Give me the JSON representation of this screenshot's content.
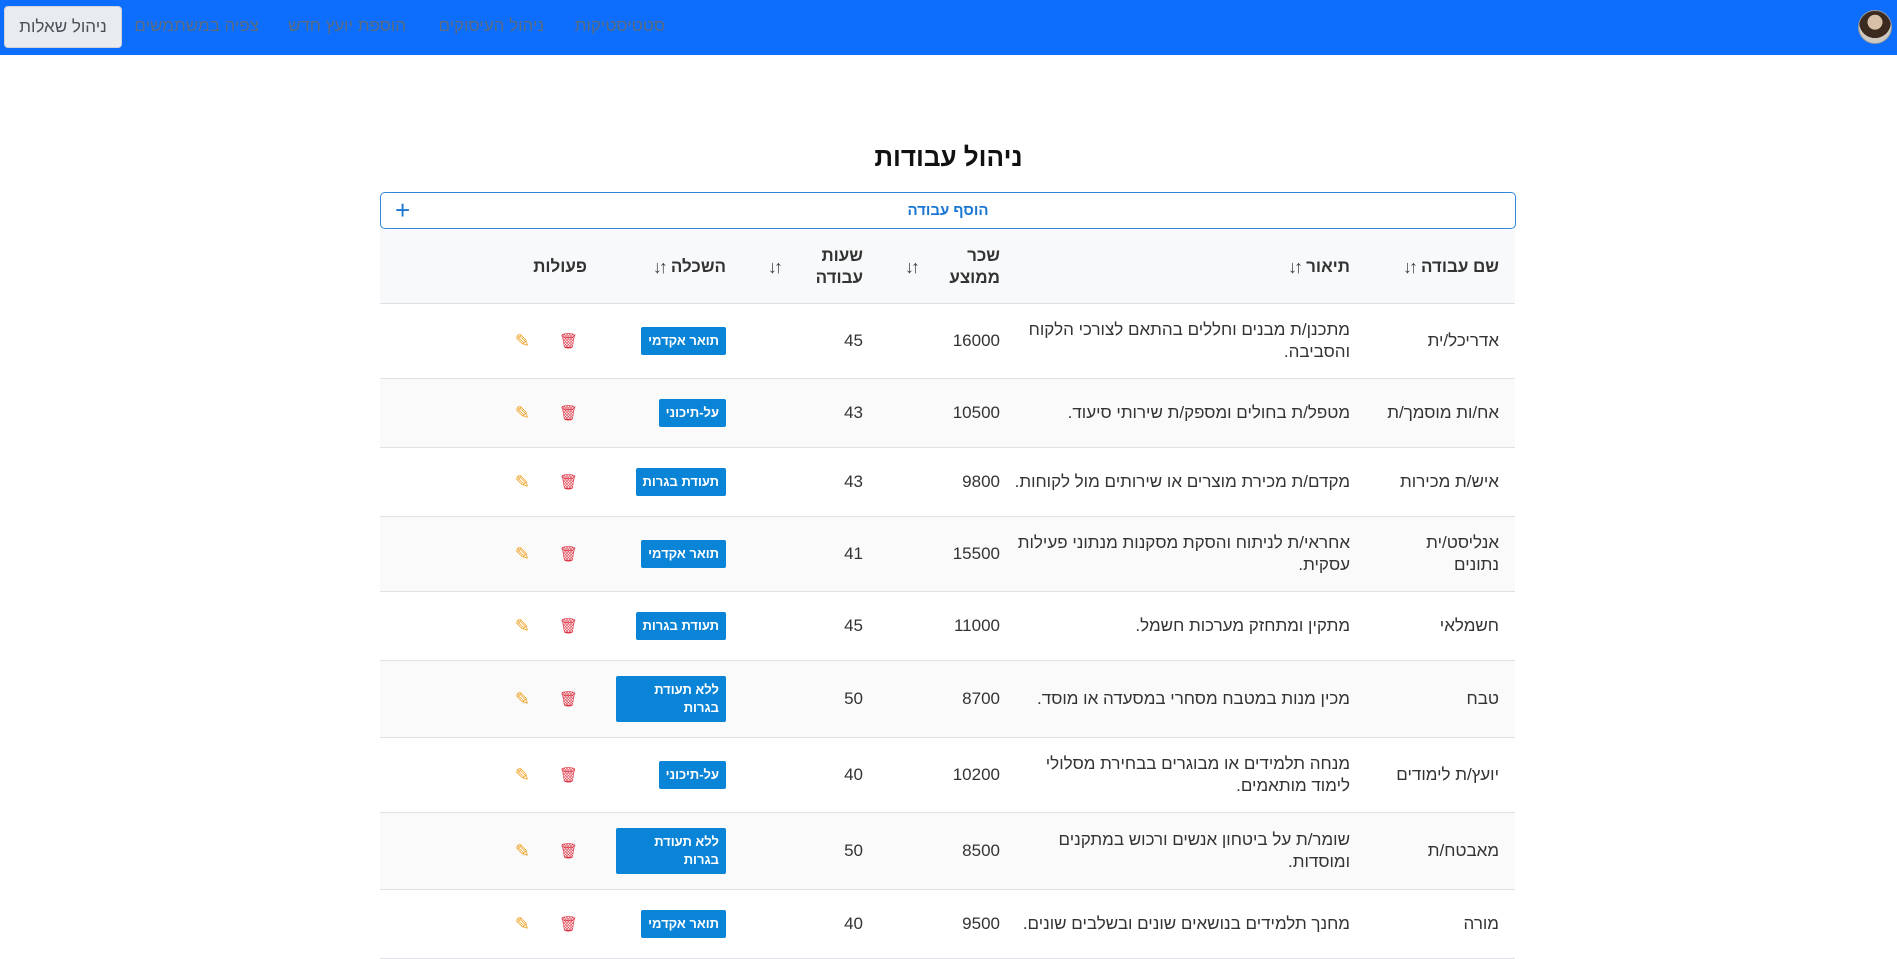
{
  "nav": {
    "active": "ניהול שאלות",
    "links": [
      "צפיה במשתמשים",
      "הוספת יועץ חדש",
      "ניהול העיסוקים",
      "סטטיסטיקות"
    ]
  },
  "page": {
    "title": "ניהול עבודות",
    "add_button": "הוסף עבודה"
  },
  "table": {
    "headers": {
      "name": "שם עבודה",
      "description": "תיאור",
      "salary": "שכר ממוצע",
      "hours": "שעות עבודה",
      "education": "השכלה",
      "actions": "פעולות"
    },
    "rows": [
      {
        "name": "אדריכל/ית",
        "description": "מתכנן/ת מבנים וחללים בהתאם לצורכי הלקוח והסביבה.",
        "salary": "16000",
        "hours": "45",
        "education": "תואר אקדמי"
      },
      {
        "name": "אח/ות מוסמך/ת",
        "description": "מטפל/ת בחולים ומספק/ת שירותי סיעוד.",
        "salary": "10500",
        "hours": "43",
        "education": "על-תיכוני"
      },
      {
        "name": "איש/ת מכירות",
        "description": "מקדם/ת מכירת מוצרים או שירותים מול לקוחות.",
        "salary": "9800",
        "hours": "43",
        "education": "תעודת בגרות"
      },
      {
        "name": "אנליסט/ית נתונים",
        "description": "אחראי/ת לניתוח והסקת מסקנות מנתוני פעילות עסקית.",
        "salary": "15500",
        "hours": "41",
        "education": "תואר אקדמי"
      },
      {
        "name": "חשמלאי",
        "description": "מתקין ומתחזק מערכות חשמל.",
        "salary": "11000",
        "hours": "45",
        "education": "תעודת בגרות"
      },
      {
        "name": "טבח",
        "description": "מכין מנות במטבח מסחרי במסעדה או מוסד.",
        "salary": "8700",
        "hours": "50",
        "education": "ללא תעודת בגרות"
      },
      {
        "name": "יועץ/ת לימודים",
        "description": "מנחה תלמידים או מבוגרים בבחירת מסלולי לימוד מותאמים.",
        "salary": "10200",
        "hours": "40",
        "education": "על-תיכוני"
      },
      {
        "name": "מאבטח/ת",
        "description": "שומר/ת על ביטחון אנשים ורכוש במתקנים ומוסדות.",
        "salary": "8500",
        "hours": "50",
        "education": "ללא תעודת בגרות"
      },
      {
        "name": "מורה",
        "description": "מחנך תלמידים בנושאים שונים ובשלבים שונים.",
        "salary": "9500",
        "hours": "40",
        "education": "תואר אקדמי"
      }
    ]
  },
  "icons": {
    "sort": "sort-icon",
    "edit": "pencil-icon",
    "delete": "trash-icon",
    "add": "plus-icon"
  },
  "colors": {
    "navbar": "#0d6efd",
    "badge": "#0a84d6",
    "edit": "#f0a020",
    "delete": "#dc3545"
  }
}
